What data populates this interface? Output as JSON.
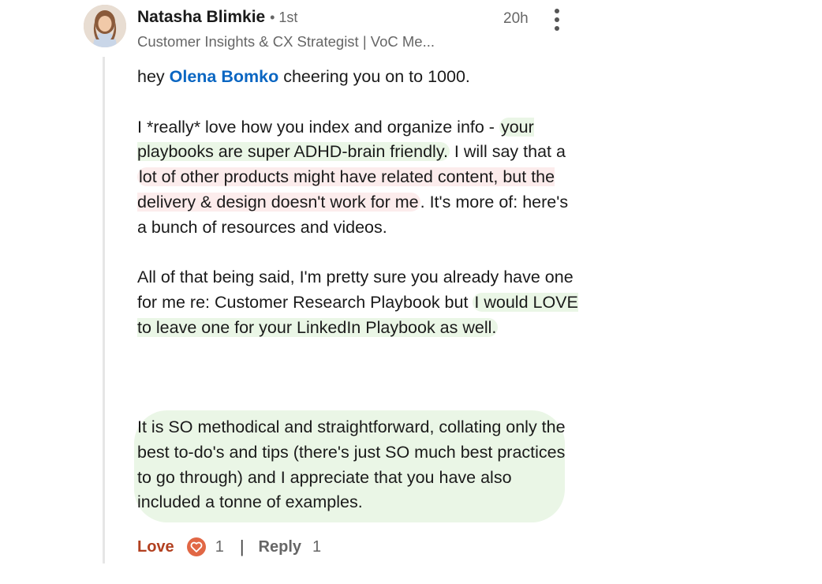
{
  "comment": {
    "author": {
      "name": "Natasha Blimkie",
      "degree": "• 1st",
      "headline": "Customer Insights & CX Strategist | VoC Me...",
      "avatar_icon": "profile-photo"
    },
    "time": "20h",
    "menu_icon": "vertical-ellipsis-icon",
    "body": {
      "p1_prefix": "hey ",
      "p1_mention": "Olena Bomko",
      "p1_suffix": " cheering you on to 1000.",
      "p2_a": "I *really* love how you index and organize info - ",
      "p2_hl1": "your playbooks are super ADHD-brain friendly.",
      "p2_b": " I will say that a ",
      "p2_hl2": "lot of other products might have related content, but the delivery & design doesn't work for me",
      "p2_c": ". It's more of: here's a bunch of resources and videos.",
      "p3_a": "All of that being said, I'm pretty sure you already have one for me re: Customer Research Playbook but ",
      "p3_hl": "I would LOVE to leave one for your LinkedIn Playbook as well.",
      "p4": "It is SO methodical and straightforward, collating only the best to-do's and tips (there's just SO much best practices to go through) and I appreciate that you have also included a tonne of examples."
    },
    "actions": {
      "love_label": "Love",
      "love_count": "1",
      "separator": "|",
      "reply_label": "Reply",
      "reply_count": "1"
    },
    "colors": {
      "mention": "#0a66c2",
      "highlight_green": "#eaf6e6",
      "highlight_red": "#fcecec",
      "love": "#b24020"
    }
  }
}
